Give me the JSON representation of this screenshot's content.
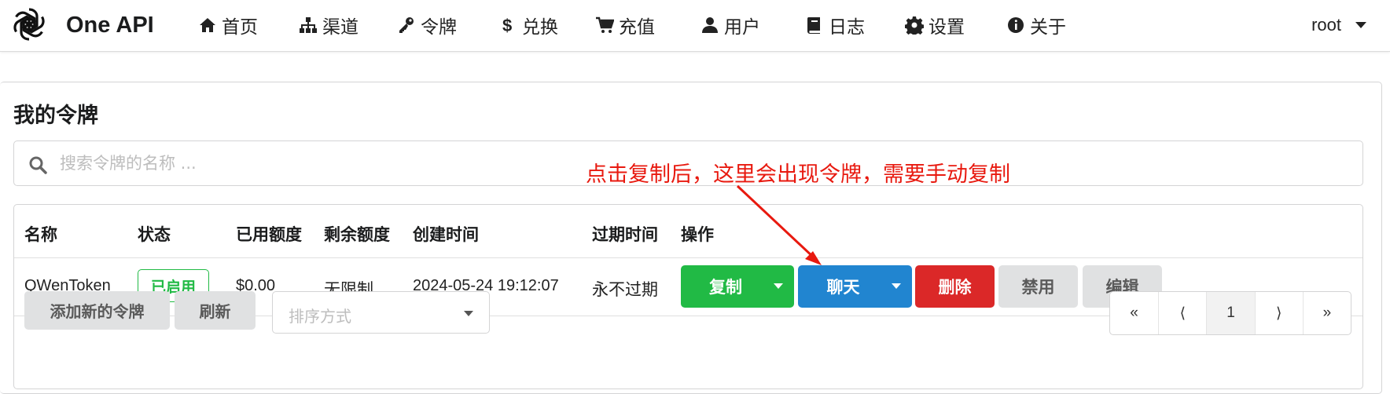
{
  "brand": {
    "name": "One API"
  },
  "nav": {
    "items": [
      {
        "label": "首页",
        "icon": "home-icon"
      },
      {
        "label": "渠道",
        "icon": "sitemap-icon"
      },
      {
        "label": "令牌",
        "icon": "key-icon"
      },
      {
        "label": "兑换",
        "icon": "dollar-icon"
      },
      {
        "label": "充值",
        "icon": "cart-icon"
      },
      {
        "label": "用户",
        "icon": "user-icon"
      },
      {
        "label": "日志",
        "icon": "book-icon"
      },
      {
        "label": "设置",
        "icon": "gear-icon"
      },
      {
        "label": "关于",
        "icon": "info-icon"
      }
    ],
    "user": "root"
  },
  "page": {
    "title": "我的令牌",
    "search_placeholder": "搜索令牌的名称 ...",
    "annotation": "点击复制后，这里会出现令牌，需要手动复制"
  },
  "table": {
    "headers": [
      "名称",
      "状态",
      "已用额度",
      "剩余额度",
      "创建时间",
      "过期时间",
      "操作"
    ],
    "rows": [
      {
        "name": "QWenToken",
        "status": "已启用",
        "used": "$0.00",
        "remaining": "无限制",
        "created": "2024-05-24 19:12:07",
        "expires": "永不过期",
        "actions": {
          "copy": "复制",
          "chat": "聊天",
          "delete": "删除",
          "disable": "禁用",
          "edit": "编辑"
        }
      }
    ]
  },
  "footer": {
    "add_button": "添加新的令牌",
    "refresh_button": "刷新",
    "sort_placeholder": "排序方式",
    "pagination": {
      "first": "«",
      "prev": "⟨",
      "current": "1",
      "next": "⟩",
      "last": "»"
    }
  },
  "colors": {
    "green": "#21ba45",
    "blue": "#2185d0",
    "red": "#db2828",
    "grey": "#e0e1e2",
    "annotation": "#e8190f"
  }
}
